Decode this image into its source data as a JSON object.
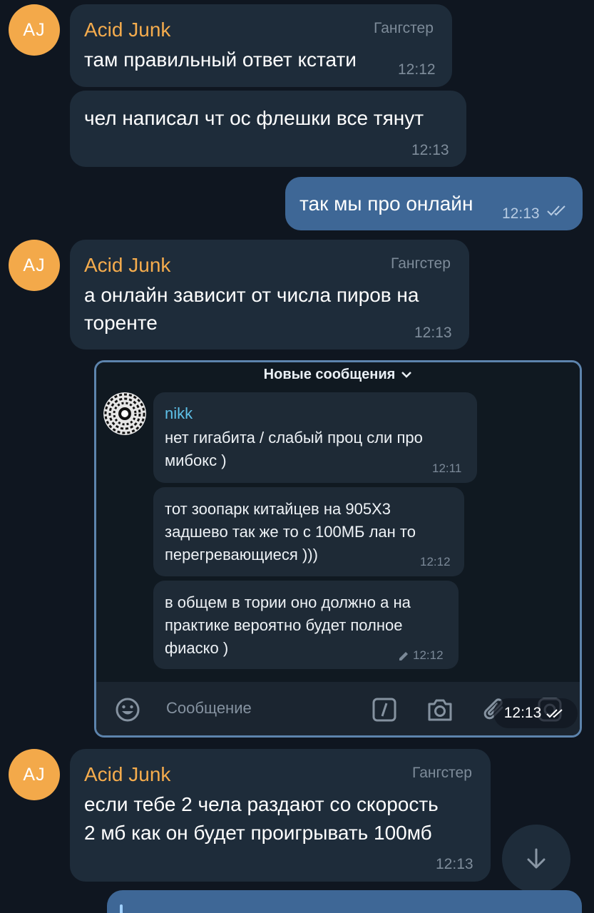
{
  "messages": [
    {
      "avatar": "AJ",
      "sender": "Acid Junk",
      "role": "Гангстер",
      "text": "там правильный ответ кстати",
      "time": "12:12"
    },
    {
      "text": "чел написал чт ос флешки все тянут",
      "time": "12:13"
    },
    {
      "outgoing": true,
      "text": "так мы про онлайн",
      "time": "12:13",
      "status": "read-double-check-icon"
    },
    {
      "avatar": "AJ",
      "sender": "Acid Junk",
      "role": "Гангстер",
      "lines": [
        "а онлайн зависит от числа пиров на",
        "торенте"
      ],
      "time": "12:13"
    },
    {
      "embedded_screenshot": {
        "header": "Новые сообщения",
        "messages": [
          {
            "sender": "nikk",
            "lines": [
              "нет гигабита / слабый проц сли про",
              "мибокс )"
            ],
            "time": "12:11"
          },
          {
            "lines": [
              "тот зоопарк китайцев на  905X3",
              "задшево так же то с 100МБ лан то",
              "перегревающиеся )))"
            ],
            "time": "12:12"
          },
          {
            "lines": [
              "в общем в тории оно должно а на",
              "практике вероятно будет полное",
              "фиаско )"
            ],
            "time": "12:12",
            "edited": true
          }
        ],
        "input_placeholder": "Сообщение",
        "icons": [
          "emoji-icon",
          "bot-command-icon",
          "camera-icon",
          "attach-icon",
          "voice-icon"
        ]
      },
      "time": "12:13",
      "status": "read-double-check-icon"
    },
    {
      "avatar": "AJ",
      "sender": "Acid Junk",
      "role": "Гангстер",
      "lines": [
        "если тебе 2 чела раздают со скорость",
        "2 мб как он будет проигрывать 100мб"
      ],
      "time": "12:13"
    }
  ],
  "colors": {
    "background": "#0f1620",
    "incoming_bubble": "#1e2c3a",
    "outgoing_bubble": "#3e6796",
    "sender_name": "#f5ac4d",
    "avatar": "#f3a94a",
    "embedded_sender": "#5ec0e8"
  }
}
